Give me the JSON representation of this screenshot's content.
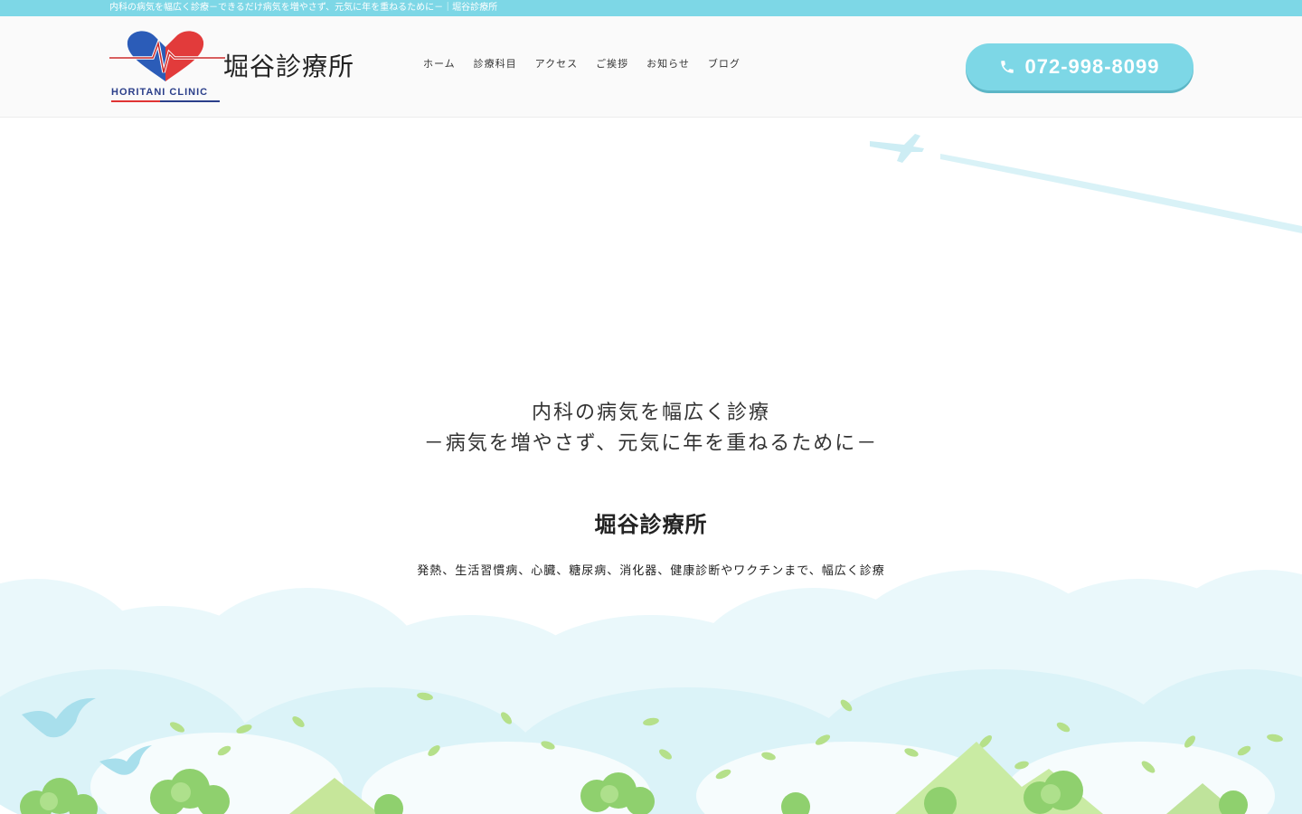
{
  "topbar": {
    "text": "内科の病気を幅広く診療－できるだけ病気を増やさず、元気に年を重ねるために－｜堀谷診療所"
  },
  "logo": {
    "name": "堀谷診療所",
    "english": "HORITANI CLINIC"
  },
  "nav": {
    "items": [
      {
        "label": "ホーム"
      },
      {
        "label": "診療科目"
      },
      {
        "label": "アクセス"
      },
      {
        "label": "ご挨拶"
      },
      {
        "label": "お知らせ"
      },
      {
        "label": "ブログ"
      }
    ]
  },
  "phone": {
    "number": "072-998-8099",
    "icon": "phone-icon"
  },
  "hero": {
    "tagline_line1": "内科の病気を幅広く診療",
    "tagline_line2": "－病気を増やさず、元気に年を重ねるために－",
    "title": "堀谷診療所",
    "description": "発熱、生活習慣病、心臓、糖尿病、消化器、健康診断やワクチンまで、幅広く診療"
  },
  "colors": {
    "accent": "#7dd7e6",
    "heart_red": "#e23b3b",
    "heart_blue": "#2b5cb8",
    "brand_navy": "#2b3f8a"
  }
}
